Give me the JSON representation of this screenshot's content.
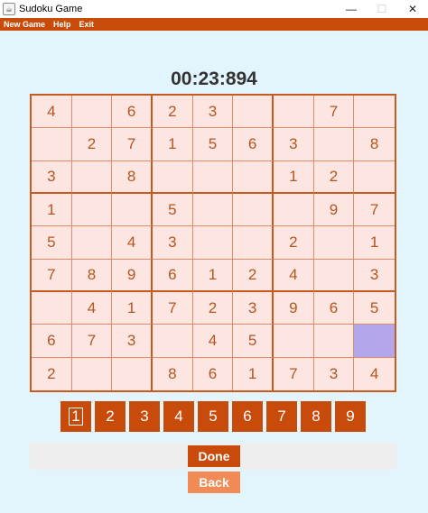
{
  "window": {
    "title": "Sudoku Game",
    "minimize": "—",
    "maximize": "☐",
    "close": "✕"
  },
  "menu": {
    "new_game": "New Game",
    "help": "Help",
    "exit": "Exit"
  },
  "timer": "00:23:894",
  "board": [
    [
      "4",
      "",
      "6",
      "2",
      "3",
      "",
      "",
      "7",
      ""
    ],
    [
      "",
      "2",
      "7",
      "1",
      "5",
      "6",
      "3",
      "",
      "8"
    ],
    [
      "3",
      "",
      "8",
      "",
      "",
      "",
      "1",
      "2",
      ""
    ],
    [
      "1",
      "",
      "",
      "5",
      "",
      "",
      "",
      "9",
      "7"
    ],
    [
      "5",
      "",
      "4",
      "3",
      "",
      "",
      "2",
      "",
      "1"
    ],
    [
      "7",
      "8",
      "9",
      "6",
      "1",
      "2",
      "4",
      "",
      "3"
    ],
    [
      "",
      "4",
      "1",
      "7",
      "2",
      "3",
      "9",
      "6",
      "5"
    ],
    [
      "6",
      "7",
      "3",
      "",
      "4",
      "5",
      "",
      "",
      ""
    ],
    [
      "2",
      "",
      "",
      "8",
      "6",
      "1",
      "7",
      "3",
      "4"
    ]
  ],
  "selected_cell": {
    "row": 8,
    "col": 9
  },
  "numpad": [
    "1",
    "2",
    "3",
    "4",
    "5",
    "6",
    "7",
    "8",
    "9"
  ],
  "buttons": {
    "done": "Done",
    "back": "Back"
  },
  "colors": {
    "accent": "#c94b0c",
    "back_button": "#f28a55",
    "cell_background": "#fde6e1",
    "selected_cell": "#b4a6ea",
    "page_background": "#e2f4fc"
  }
}
